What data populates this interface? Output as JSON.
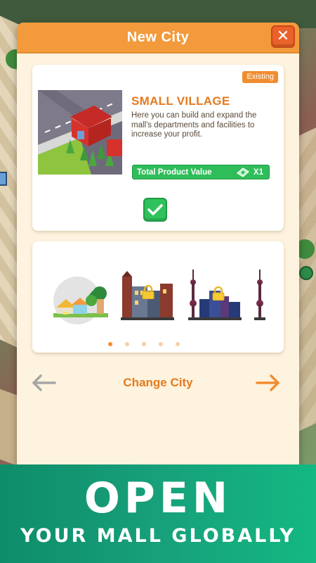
{
  "dialog": {
    "title": "New City",
    "close_icon": "close-icon"
  },
  "city": {
    "status": "Existing",
    "name": "SMALL VILLAGE",
    "description": "Here you can build and expand the mall's departments and facilities to increase your profit.",
    "value_label": "Total Product Value",
    "value_multiplier": "X1",
    "value_icon": "money-icon",
    "selected": true,
    "selected_icon": "checkmark-icon"
  },
  "carousel": {
    "cities": [
      {
        "id": "small-village",
        "locked": false,
        "selected": true
      },
      {
        "id": "old-town",
        "locked": true,
        "selected": false
      },
      {
        "id": "metropolis",
        "locked": true,
        "selected": false
      },
      {
        "id": "tower-city",
        "locked": true,
        "selected": false
      }
    ],
    "page_count": 5,
    "active_page": 1
  },
  "nav": {
    "change_label": "Change City",
    "prev_icon": "arrow-left-icon",
    "next_icon": "arrow-right-icon"
  },
  "banner": {
    "title": "OPEN",
    "subtitle": "YOUR MALL GLOBALLY"
  },
  "colors": {
    "header": "#f29a3c",
    "accent": "#e57a1e",
    "confirm": "#2fbd5a",
    "banner": "#13b882"
  }
}
